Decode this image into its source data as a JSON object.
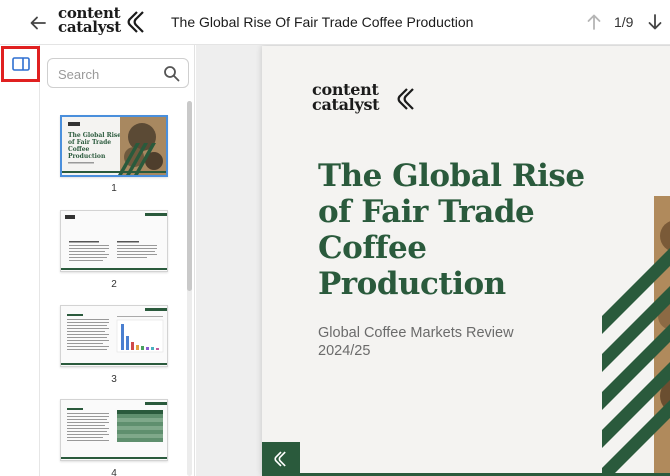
{
  "header": {
    "logo_line1": "content",
    "logo_line2": "catalyst",
    "doc_title": "The Global Rise Of Fair Trade Coffee Production",
    "page_counter": "1/9",
    "back_icon": "arrow-left-icon",
    "prev_icon": "arrow-up-icon",
    "next_icon": "arrow-down-icon"
  },
  "rail": {
    "toggle_icon": "sidebar-panel-icon",
    "highlight_color": "#e02020"
  },
  "sidebar": {
    "search_placeholder": "Search",
    "search_icon": "search-icon",
    "thumbnails": [
      {
        "label": "1",
        "active": true
      },
      {
        "label": "2",
        "active": false
      },
      {
        "label": "3",
        "active": false
      },
      {
        "label": "4",
        "active": false
      }
    ],
    "thumb1_title": "The Global Rise of Fair Trade Coffee Production"
  },
  "page": {
    "logo_line1": "content",
    "logo_line2": "catalyst",
    "title_lines": [
      "The Global Rise",
      "of Fair Trade",
      "Coffee",
      "Production"
    ],
    "subtitle_lines": [
      "Global Coffee Markets Review",
      "2024/25"
    ]
  },
  "colors": {
    "brand_green": "#2a5a3c",
    "active_thumb_border": "#4a8fdc",
    "page_background": "#f4f3f1"
  }
}
